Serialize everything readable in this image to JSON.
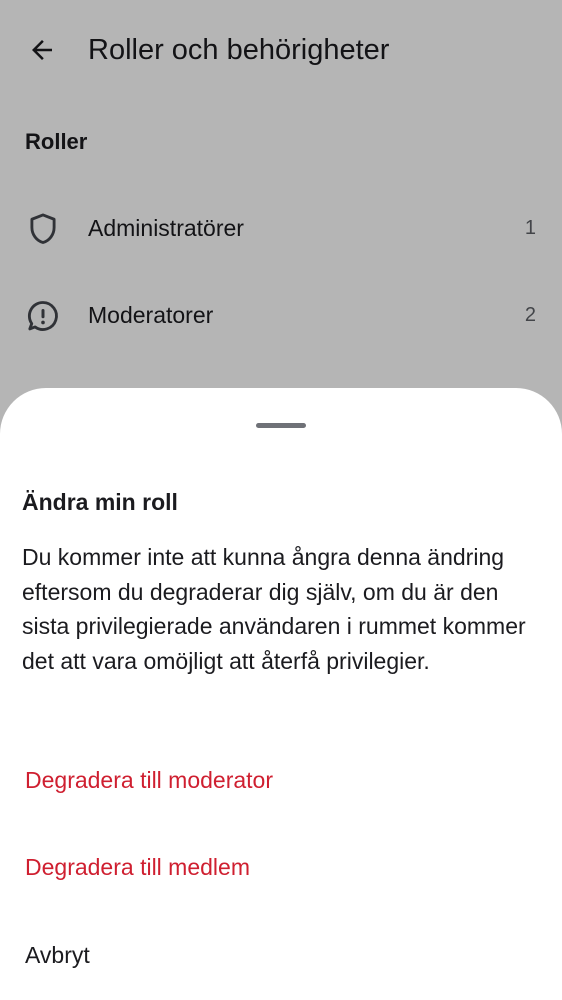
{
  "header": {
    "title": "Roller och behörigheter"
  },
  "roles_section": {
    "heading": "Roller",
    "items": [
      {
        "label": "Administratörer",
        "count": "1",
        "icon": "shield-icon"
      },
      {
        "label": "Moderatorer",
        "count": "2",
        "icon": "moderator-icon"
      }
    ]
  },
  "sheet": {
    "title": "Ändra min roll",
    "message": "Du kommer inte att kunna ångra denna ändring eftersom du degraderar dig själv, om du är den sista privilegierade användaren i rummet kommer det att vara omöjligt att återfå privilegier.",
    "actions": {
      "demote_to_moderator": "Degradera till moderator",
      "demote_to_member": "Degradera till medlem",
      "cancel": "Avbryt"
    }
  },
  "colors": {
    "danger": "#cf1f30",
    "text": "#1b1b1f",
    "scrim": "rgba(0,0,0,0.29)"
  }
}
